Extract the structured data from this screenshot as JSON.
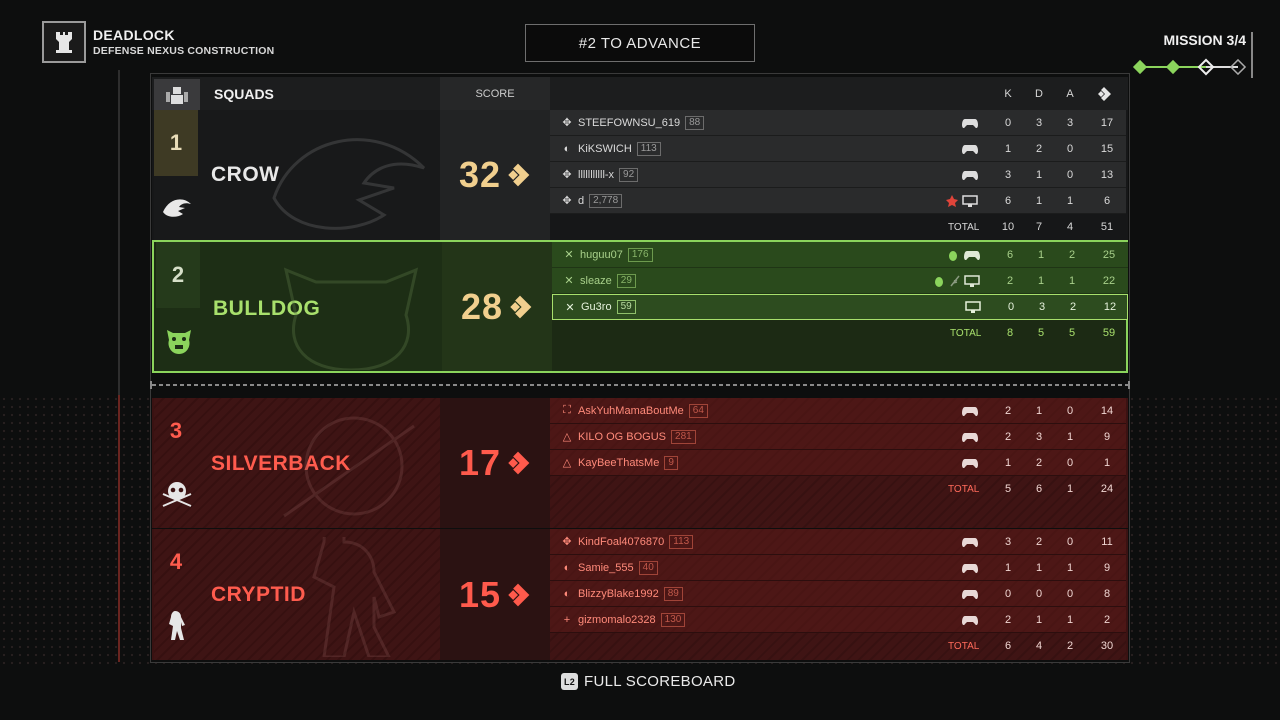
{
  "mode": {
    "title": "DEADLOCK",
    "subtitle": "DEFENSE NEXUS CONSTRUCTION",
    "icon": "rook-icon"
  },
  "advance_banner": "#2 TO ADVANCE",
  "mission": {
    "label": "MISSION 3/4",
    "completed": 2,
    "total": 4
  },
  "header": {
    "squads_label": "SQUADS",
    "score_label": "SCORE",
    "k": "K",
    "d": "D",
    "a": "A"
  },
  "total_label": "TOTAL",
  "squads": [
    {
      "rank": "1",
      "name": "CROW",
      "score": "32",
      "players": [
        {
          "icon": "✥",
          "name": "STEEFOWNSU_619",
          "level": "88",
          "device": "controller",
          "k": "0",
          "d": "3",
          "a": "3",
          "p": "17"
        },
        {
          "icon": "◐",
          "name": "KiKSWICH",
          "level": "113",
          "device": "controller",
          "k": "1",
          "d": "2",
          "a": "0",
          "p": "15"
        },
        {
          "icon": "✥",
          "name": "lllllllllll-x",
          "level": "92",
          "device": "controller",
          "k": "3",
          "d": "1",
          "a": "0",
          "p": "13"
        },
        {
          "icon": "✥",
          "name": "d",
          "level": "2,778",
          "device": "pc",
          "k": "6",
          "d": "1",
          "a": "1",
          "p": "6"
        }
      ],
      "totals": {
        "k": "10",
        "d": "7",
        "a": "4",
        "p": "51"
      }
    },
    {
      "rank": "2",
      "name": "BULLDOG",
      "score": "28",
      "players": [
        {
          "icon": "✕",
          "name": "huguu07",
          "level": "176",
          "device": "controller",
          "k": "6",
          "d": "1",
          "a": "2",
          "p": "25"
        },
        {
          "icon": "✕",
          "name": "sleaze",
          "level": "29",
          "device": "pc",
          "k": "2",
          "d": "1",
          "a": "1",
          "p": "22"
        },
        {
          "icon": "✕",
          "name": "Gu3ro",
          "level": "59",
          "device": "pc",
          "k": "0",
          "d": "3",
          "a": "2",
          "p": "12"
        }
      ],
      "totals": {
        "k": "8",
        "d": "5",
        "a": "5",
        "p": "59"
      }
    },
    {
      "rank": "3",
      "name": "SILVERBACK",
      "score": "17",
      "players": [
        {
          "icon": "⛶",
          "name": "AskYuhMamaBoutMe",
          "level": "64",
          "device": "controller",
          "k": "2",
          "d": "1",
          "a": "0",
          "p": "14"
        },
        {
          "icon": "△",
          "name": "KILO OG BOGUS",
          "level": "281",
          "device": "controller",
          "k": "2",
          "d": "3",
          "a": "1",
          "p": "9"
        },
        {
          "icon": "△",
          "name": "KayBeeThatsMe",
          "level": "9",
          "device": "controller",
          "k": "1",
          "d": "2",
          "a": "0",
          "p": "1"
        }
      ],
      "totals": {
        "k": "5",
        "d": "6",
        "a": "1",
        "p": "24"
      }
    },
    {
      "rank": "4",
      "name": "CRYPTID",
      "score": "15",
      "players": [
        {
          "icon": "✥",
          "name": "KindFoal4076870",
          "level": "113",
          "device": "controller",
          "k": "3",
          "d": "2",
          "a": "0",
          "p": "11"
        },
        {
          "icon": "◐",
          "name": "Samie_555",
          "level": "40",
          "device": "controller",
          "k": "1",
          "d": "1",
          "a": "1",
          "p": "9"
        },
        {
          "icon": "◐",
          "name": "BlizzyBlake1992",
          "level": "89",
          "device": "controller",
          "k": "0",
          "d": "0",
          "a": "0",
          "p": "8"
        },
        {
          "icon": "+",
          "name": "gizmomalo2328",
          "level": "130",
          "device": "controller",
          "k": "2",
          "d": "1",
          "a": "1",
          "p": "2"
        }
      ],
      "totals": {
        "k": "6",
        "d": "4",
        "a": "2",
        "p": "30"
      }
    }
  ],
  "footer": {
    "button": "L2",
    "label": "FULL SCOREBOARD"
  },
  "colors": {
    "gold": "#f1cf8e",
    "green": "#8bd45c",
    "red": "#ff5c4e"
  }
}
